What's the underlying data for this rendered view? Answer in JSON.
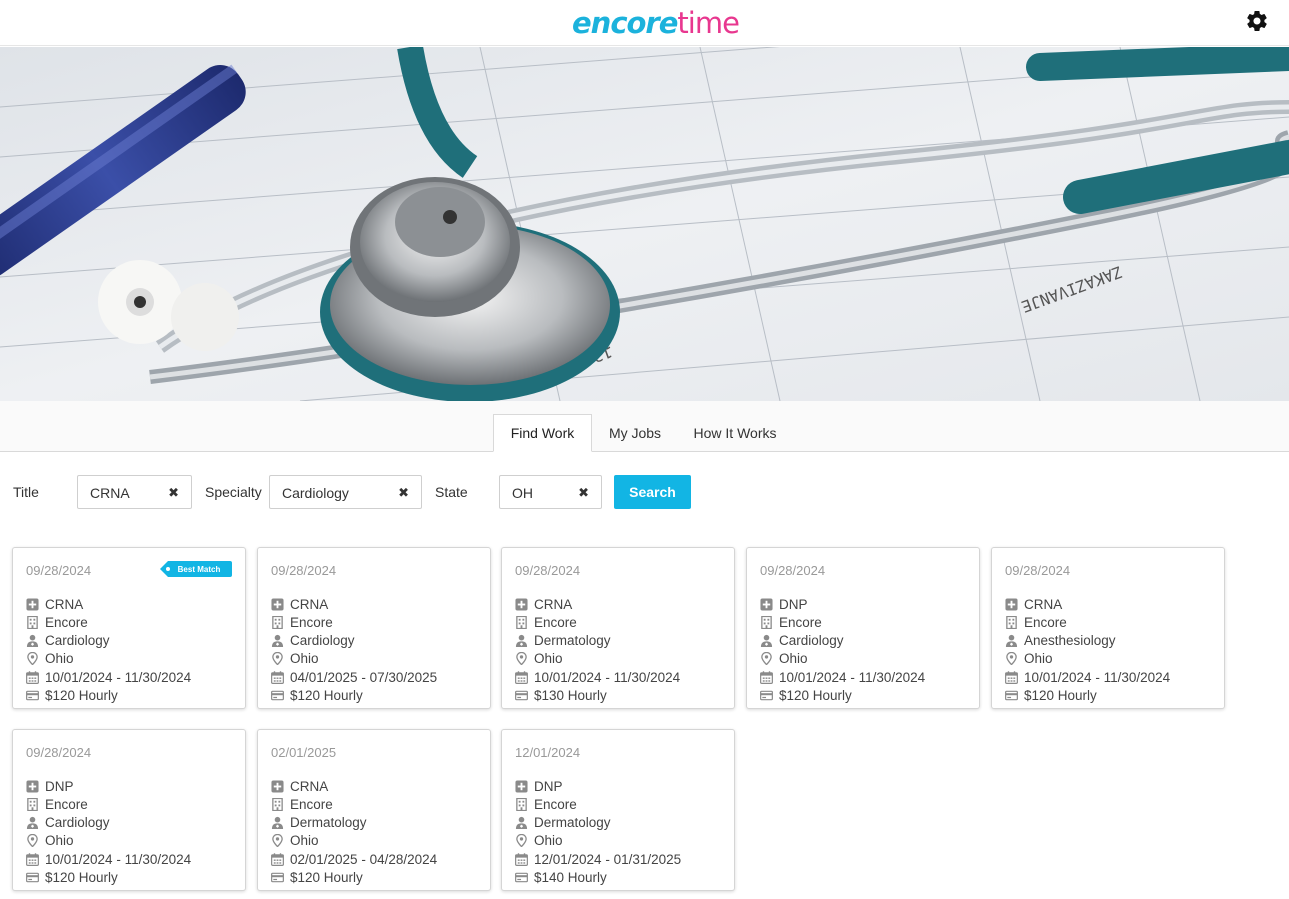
{
  "header": {
    "logo_part1": "encore",
    "logo_part2": "time"
  },
  "tabs": [
    {
      "label": "Find Work",
      "active": true
    },
    {
      "label": "My Jobs",
      "active": false
    },
    {
      "label": "How It Works",
      "active": false
    }
  ],
  "filters": {
    "title_label": "Title",
    "title_value": "CRNA",
    "specialty_label": "Specialty",
    "specialty_value": "Cardiology",
    "state_label": "State",
    "state_value": "OH",
    "clear_symbol": "✖",
    "search_label": "Search"
  },
  "badge_label": "Best Match",
  "jobs": [
    {
      "date": "09/28/2024",
      "title": "CRNA",
      "company": "Encore",
      "specialty": "Cardiology",
      "location": "Ohio",
      "dates": "10/01/2024 - 11/30/2024",
      "rate": "$120 Hourly",
      "best_match": true
    },
    {
      "date": "09/28/2024",
      "title": "CRNA",
      "company": "Encore",
      "specialty": "Cardiology",
      "location": "Ohio",
      "dates": "04/01/2025 - 07/30/2025",
      "rate": "$120 Hourly",
      "best_match": false
    },
    {
      "date": "09/28/2024",
      "title": "CRNA",
      "company": "Encore",
      "specialty": "Dermatology",
      "location": "Ohio",
      "dates": "10/01/2024 - 11/30/2024",
      "rate": "$130 Hourly",
      "best_match": false
    },
    {
      "date": "09/28/2024",
      "title": "DNP",
      "company": "Encore",
      "specialty": "Cardiology",
      "location": "Ohio",
      "dates": "10/01/2024 - 11/30/2024",
      "rate": "$120 Hourly",
      "best_match": false
    },
    {
      "date": "09/28/2024",
      "title": "CRNA",
      "company": "Encore",
      "specialty": "Anesthesiology",
      "location": "Ohio",
      "dates": "10/01/2024 - 11/30/2024",
      "rate": "$120 Hourly",
      "best_match": false
    },
    {
      "date": "09/28/2024",
      "title": "DNP",
      "company": "Encore",
      "specialty": "Cardiology",
      "location": "Ohio",
      "dates": "10/01/2024 - 11/30/2024",
      "rate": "$120 Hourly",
      "best_match": false
    },
    {
      "date": "02/01/2025",
      "title": "CRNA",
      "company": "Encore",
      "specialty": "Dermatology",
      "location": "Ohio",
      "dates": "02/01/2025 - 04/28/2024",
      "rate": "$120 Hourly",
      "best_match": false
    },
    {
      "date": "12/01/2024",
      "title": "DNP",
      "company": "Encore",
      "specialty": "Dermatology",
      "location": "Ohio",
      "dates": "12/01/2024 - 01/31/2025",
      "rate": "$140 Hourly",
      "best_match": false
    }
  ],
  "icons": {
    "title": "medical-cross-icon",
    "company": "building-icon",
    "specialty": "doctor-icon",
    "location": "map-pin-icon",
    "dates": "calendar-icon",
    "rate": "credit-card-icon",
    "settings": "gear-icon"
  },
  "colors": {
    "accent": "#12b5e4",
    "logo_blue": "#1bb2dc",
    "logo_pink": "#e8378f"
  }
}
